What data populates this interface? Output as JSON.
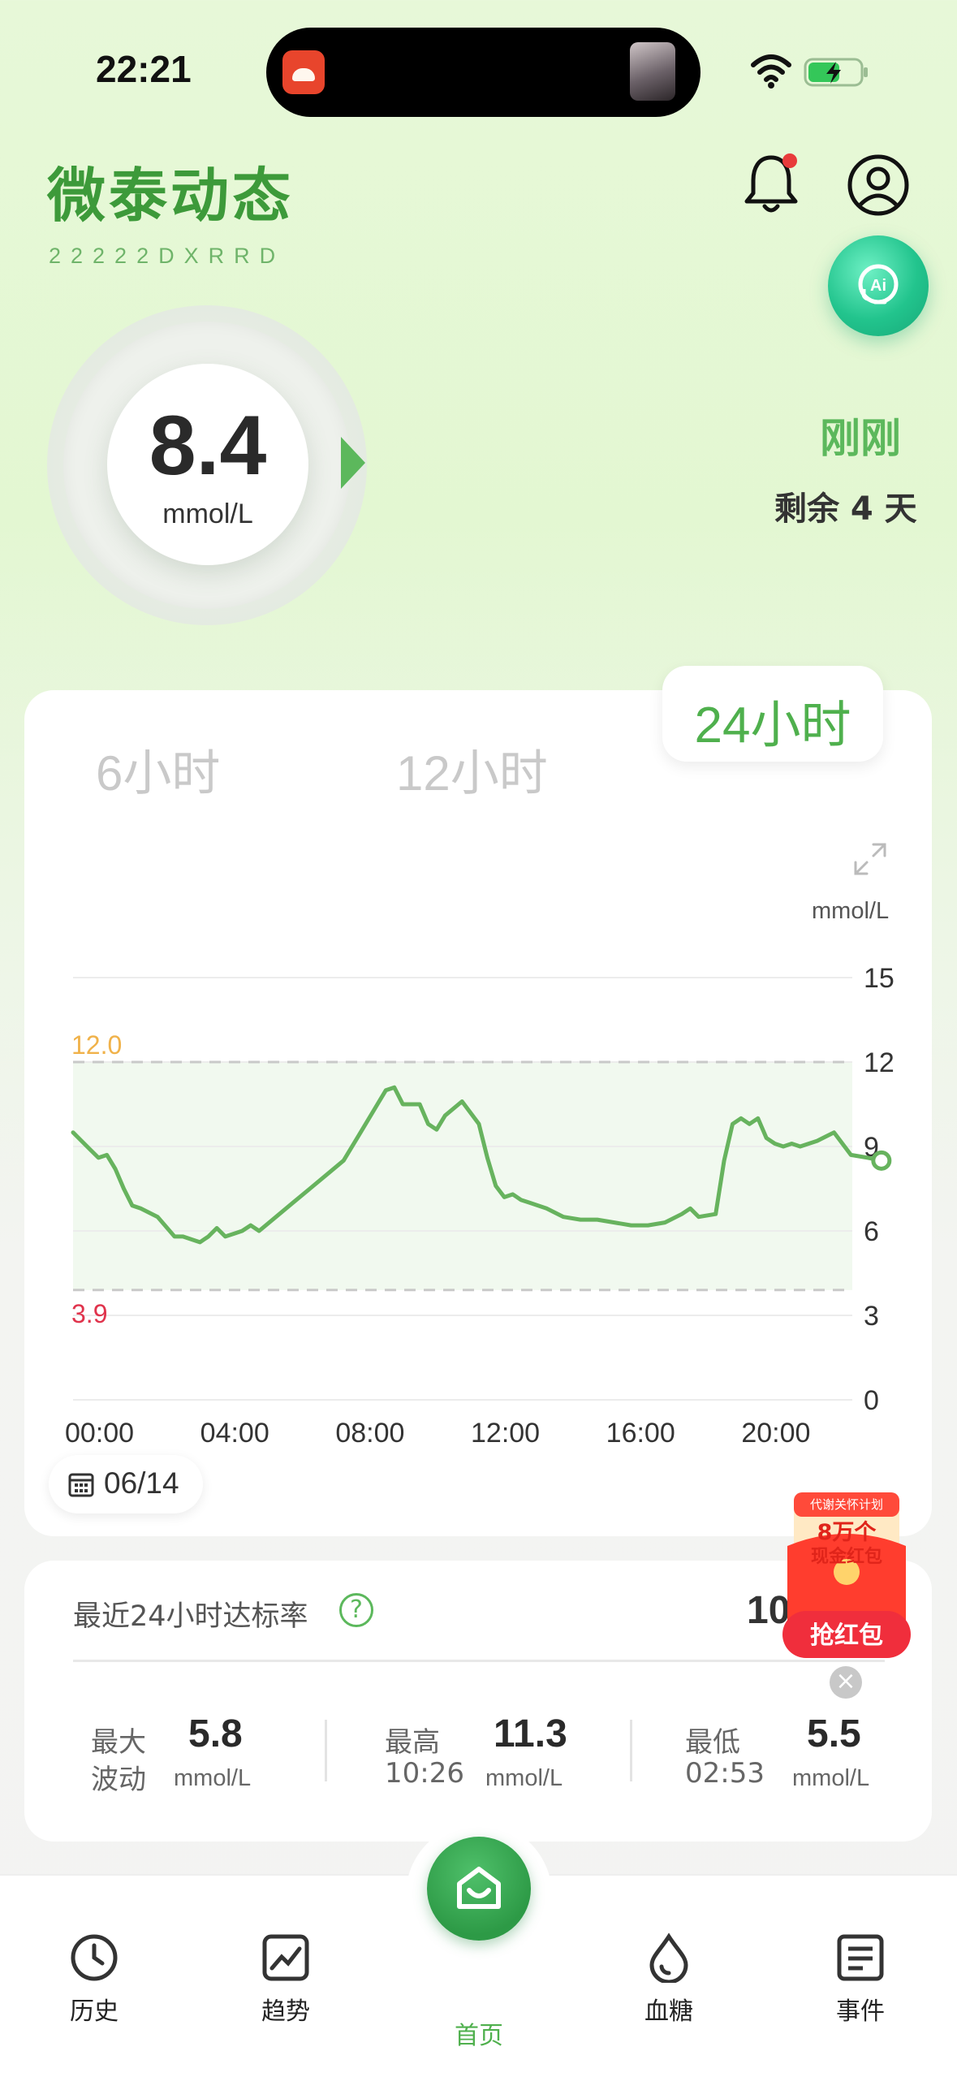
{
  "status_bar": {
    "time": "22:21"
  },
  "header": {
    "title": "微泰动态",
    "serial": "22222DXRRD"
  },
  "glucose": {
    "value": "8.4",
    "unit": "mmol/L",
    "updated": "刚刚",
    "remaining": "剩余 4 天"
  },
  "chart_tabs": [
    {
      "label": "6小时",
      "active": false
    },
    {
      "label": "12小时",
      "active": false
    },
    {
      "label": "24小时",
      "active": true
    }
  ],
  "chart_data": {
    "type": "line",
    "ylabel": "mmol/L",
    "ylim": [
      0,
      15
    ],
    "yticks": [
      "15",
      "12",
      "9",
      "6",
      "3",
      "0"
    ],
    "xticks": [
      "00:00",
      "04:00",
      "08:00",
      "12:00",
      "16:00",
      "20:00"
    ],
    "target_range": {
      "high": "12.0",
      "low": "3.9"
    },
    "series": [
      {
        "x": [
          0,
          0.5,
          0.75,
          1,
          1.25,
          1.5,
          1.75,
          2,
          2.5,
          3,
          3.25,
          3.5,
          3.75,
          4,
          4.25,
          4.5,
          4.75,
          5,
          5.25,
          5.5,
          6,
          6.5,
          7,
          7.5,
          8,
          8.5,
          9,
          9.25,
          9.5,
          9.75,
          10,
          10.25,
          10.5,
          10.75,
          11,
          11.5,
          12,
          12.25,
          12.5,
          12.75,
          13,
          13.25,
          13.5,
          14,
          14.5,
          15,
          15.5,
          16,
          16.5,
          17,
          17.5,
          18,
          18.25,
          18.5,
          19,
          19.25,
          19.5,
          19.75,
          20,
          20.25,
          20.5,
          20.75,
          21,
          21.25,
          21.5,
          22,
          22.5,
          23,
          23.5,
          23.9
        ],
        "values": [
          9.5,
          8.9,
          8.6,
          8.7,
          8.2,
          7.5,
          6.9,
          6.8,
          6.5,
          5.8,
          5.8,
          5.7,
          5.6,
          5.8,
          6.1,
          5.8,
          5.9,
          6.0,
          6.2,
          6.0,
          6.5,
          7.0,
          7.5,
          8.0,
          8.5,
          9.5,
          10.5,
          11.0,
          11.1,
          10.5,
          10.5,
          10.5,
          9.8,
          9.6,
          10.1,
          10.6,
          9.8,
          8.6,
          7.6,
          7.2,
          7.3,
          7.1,
          7.0,
          6.8,
          6.5,
          6.4,
          6.4,
          6.3,
          6.2,
          6.2,
          6.3,
          6.6,
          6.8,
          6.5,
          6.6,
          8.5,
          9.8,
          10.0,
          9.8,
          10.0,
          9.3,
          9.1,
          9.0,
          9.1,
          9.0,
          9.2,
          9.5,
          8.7,
          8.6,
          8.5
        ]
      }
    ]
  },
  "chart_footer": {
    "date": "06/14",
    "expand_icon": "expand-icon"
  },
  "stats": {
    "rate_label": "最近24小时达标率",
    "rate_value": "10",
    "max_fluct": {
      "label1": "最大",
      "label2": "波动",
      "value": "5.8",
      "unit": "mmol/L"
    },
    "highest": {
      "label": "最高",
      "time": "10:26",
      "value": "11.3",
      "unit": "mmol/L"
    },
    "lowest": {
      "label": "最低",
      "time": "02:53",
      "value": "5.5",
      "unit": "mmol/L"
    }
  },
  "promo": {
    "line1": "代谢关怀计划",
    "line2": "8万个",
    "line3": "现金红包",
    "button": "抢红包"
  },
  "nav": [
    {
      "label": "历史",
      "icon": "history-icon"
    },
    {
      "label": "趋势",
      "icon": "trend-icon"
    },
    {
      "label": "首页",
      "icon": "home-icon",
      "active": true
    },
    {
      "label": "血糖",
      "icon": "blood-drop-icon"
    },
    {
      "label": "事件",
      "icon": "event-icon"
    }
  ],
  "colors": {
    "accent": "#4fb04d",
    "high_line": "#f0b24a",
    "low_line": "#e0334c",
    "line": "#67b35e"
  }
}
